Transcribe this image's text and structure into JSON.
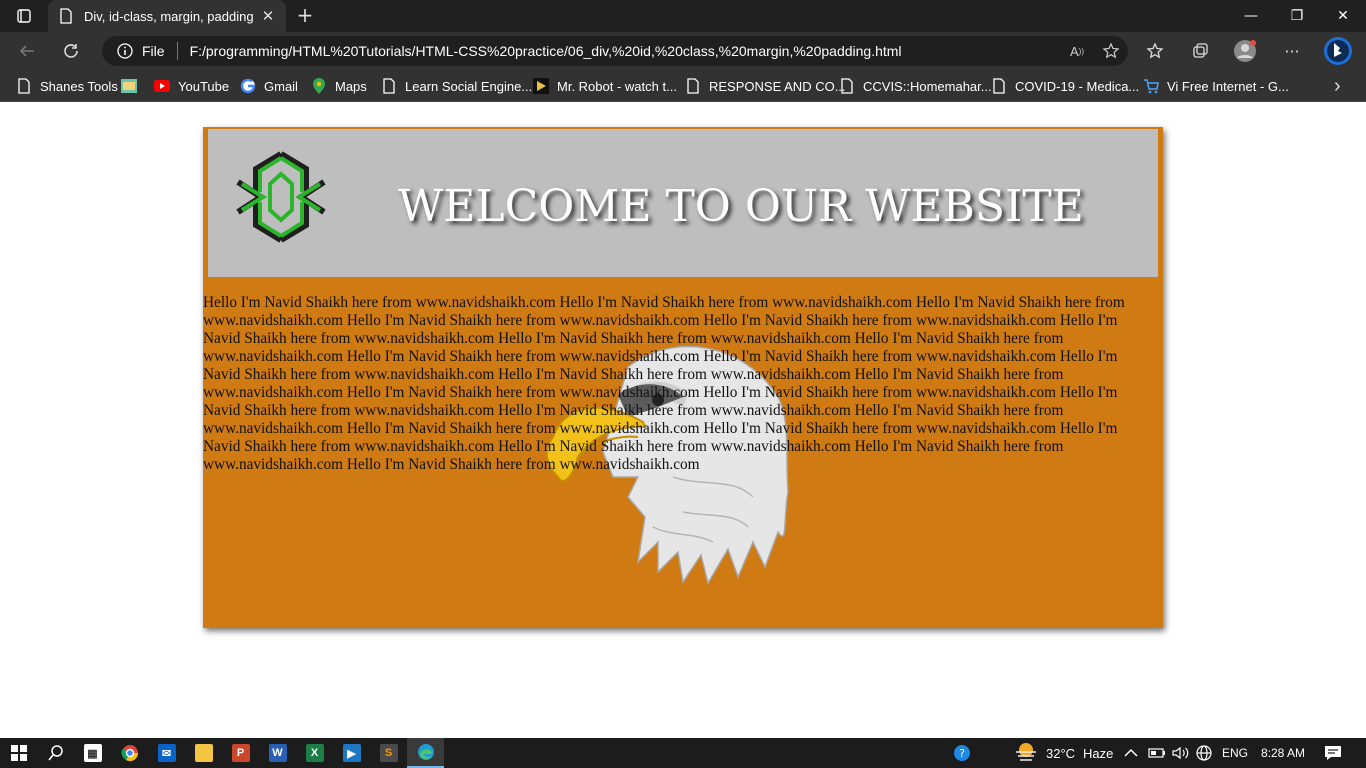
{
  "browser": {
    "tab": {
      "title": "Div, id-class, margin, padding",
      "close_glyph": "✕"
    },
    "new_tab_glyph": "+",
    "window_controls": {
      "minimize": "—",
      "restore": "❐",
      "close": "✕"
    },
    "address": {
      "scheme_label": "File",
      "url": "F:/programming/HTML%20Tutorials/HTML-CSS%20practice/06_div,%20id,%20class,%20margin,%20padding.html"
    },
    "more_glyph": "···",
    "bookmarks": [
      {
        "label": "Shanes Tools",
        "icon": "page-icon"
      },
      {
        "label": "",
        "icon": "image-icon"
      },
      {
        "label": "YouTube",
        "icon": "youtube-icon"
      },
      {
        "label": "Gmail",
        "icon": "google-icon"
      },
      {
        "label": "Maps",
        "icon": "maps-icon"
      },
      {
        "label": "Learn Social Engine...",
        "icon": "page-icon"
      },
      {
        "label": "Mr. Robot - watch t...",
        "icon": "play-icon"
      },
      {
        "label": "RESPONSE AND CO...",
        "icon": "page-icon"
      },
      {
        "label": "CCVIS::Homemahar...",
        "icon": "page-icon"
      },
      {
        "label": "COVID-19 - Medica...",
        "icon": "page-icon"
      },
      {
        "label": "Vi Free Internet - G...",
        "icon": "cart-icon"
      }
    ],
    "bookmarks_more_glyph": "›"
  },
  "page": {
    "heading": "WELCOME TO OUR WEBSITE",
    "paragraph": "Hello I'm Navid Shaikh here from www.navidshaikh.com Hello I'm Navid Shaikh here from www.navidshaikh.com Hello I'm Navid Shaikh here from www.navidshaikh.com Hello I'm Navid Shaikh here from www.navidshaikh.com Hello I'm Navid Shaikh here from www.navidshaikh.com Hello I'm Navid Shaikh here from www.navidshaikh.com Hello I'm Navid Shaikh here from www.navidshaikh.com Hello I'm Navid Shaikh here from www.navidshaikh.com Hello I'm Navid Shaikh here from www.navidshaikh.com Hello I'm Navid Shaikh here from www.navidshaikh.com Hello I'm Navid Shaikh here from www.navidshaikh.com Hello I'm Navid Shaikh here from www.navidshaikh.com Hello I'm Navid Shaikh here from www.navidshaikh.com Hello I'm Navid Shaikh here from www.navidshaikh.com Hello I'm Navid Shaikh here from www.navidshaikh.com Hello I'm Navid Shaikh here from www.navidshaikh.com Hello I'm Navid Shaikh here from www.navidshaikh.com Hello I'm Navid Shaikh here from www.navidshaikh.com Hello I'm Navid Shaikh here from www.navidshaikh.com Hello I'm Navid Shaikh here from www.navidshaikh.com Hello I'm Navid Shaikh here from www.navidshaikh.com Hello I'm Navid Shaikh here from www.navidshaikh.com Hello I'm Navid Shaikh here from www.navidshaikh.com Hello I'm Navid Shaikh here from www.navidshaikh.com",
    "colors": {
      "box": "#d07a14",
      "header": "#bebebe",
      "heading_text": "#ffffff"
    }
  },
  "taskbar": {
    "apps": [
      "windows-start",
      "search",
      "store",
      "chrome",
      "mail",
      "file-explorer",
      "powerpoint",
      "word",
      "excel",
      "video-app",
      "sublime-text",
      "edge"
    ],
    "weather": {
      "temp": "32°C",
      "condition": "Haze"
    },
    "language": "ENG",
    "time": "8:28 AM"
  }
}
